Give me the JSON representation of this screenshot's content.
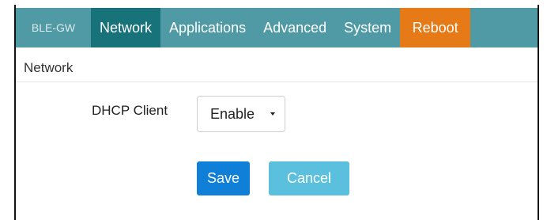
{
  "navbar": {
    "brand": "BLE-GW",
    "items": [
      {
        "label": "Network",
        "active": true
      },
      {
        "label": "Applications"
      },
      {
        "label": "Advanced"
      },
      {
        "label": "System"
      },
      {
        "label": "Reboot",
        "color": "#e67a17"
      }
    ],
    "colors": {
      "bar": "#4f9aa5",
      "active": "#17727a",
      "reboot": "#e67a17"
    }
  },
  "section": {
    "title": "Network"
  },
  "form": {
    "dhcp_label": "DHCP Client",
    "dhcp_value": "Enable"
  },
  "buttons": {
    "save": "Save",
    "cancel": "Cancel",
    "colors": {
      "save": "#0f7fd8",
      "cancel": "#5bc0de"
    }
  }
}
